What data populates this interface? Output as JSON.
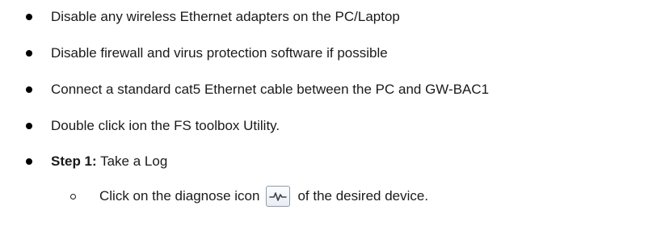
{
  "bullets": [
    {
      "text": "Disable any wireless Ethernet adapters on the PC/Laptop"
    },
    {
      "text": "Disable firewall and virus protection software if possible"
    },
    {
      "text": "Connect a standard cat5 Ethernet cable between the PC and GW-BAC1"
    },
    {
      "text": "Double click ion the FS toolbox Utility."
    },
    {
      "bold": "Step 1:",
      "text": " Take a Log"
    }
  ],
  "sub_bullet": {
    "before_icon": "Click on the diagnose icon",
    "icon": "diagnose-icon",
    "after_icon": "of the desired device."
  }
}
